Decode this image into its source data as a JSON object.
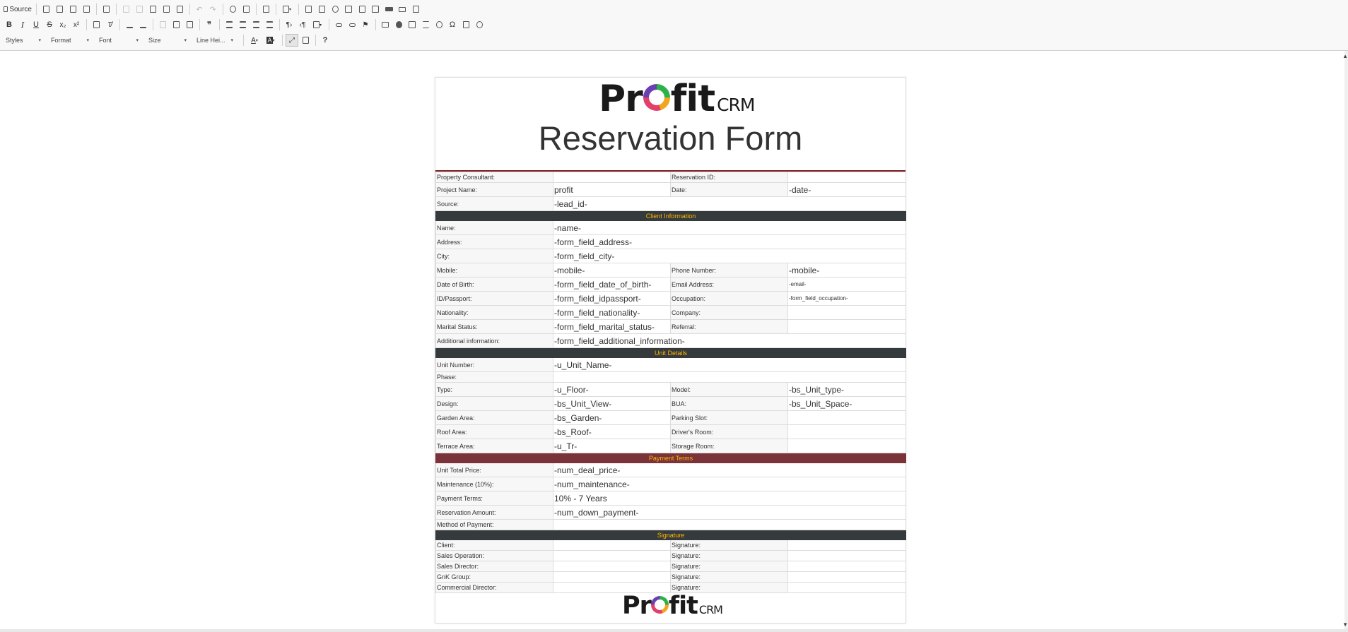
{
  "toolbar": {
    "source_label": "Source",
    "styles_label": "Styles",
    "format_label": "Format",
    "font_label": "Font",
    "size_label": "Size",
    "line_height_label": "Line Hei...",
    "bold": "B",
    "italic": "I",
    "underline": "U",
    "strike": "S",
    "subscript": "x₂",
    "superscript": "x²",
    "blockquote": "❞",
    "omega": "Ω",
    "help": "?",
    "text_color": "A",
    "bg_color": "A"
  },
  "document": {
    "logo": {
      "pro": "Pr",
      "fit": "fit",
      "crm": "CRM"
    },
    "title": "Reservation Form",
    "header_rows": [
      {
        "l1": "Property Consultant:",
        "v1": "",
        "l2": "Reservation ID:",
        "v2": ""
      },
      {
        "l1": "Project Name:",
        "v1": "profit",
        "l2": "Date:",
        "v2": "-date-"
      }
    ],
    "source": {
      "label": "Source:",
      "value": "-lead_id-"
    },
    "sections": {
      "client": "Client Information",
      "unit": "Unit Details",
      "payment": "Payment Terms",
      "signature": "Signature"
    },
    "client": {
      "name": {
        "label": "Name:",
        "value": "-name-"
      },
      "address": {
        "label": "Address:",
        "value": "-form_field_address-"
      },
      "city": {
        "label": "City:",
        "value": "-form_field_city-"
      },
      "mobile": {
        "label": "Mobile:",
        "value": "-mobile-",
        "label2": "Phone Number:",
        "value2": "-mobile-"
      },
      "dob": {
        "label": "Date of Birth:",
        "value": "-form_field_date_of_birth-",
        "label2": "Email Address:",
        "value2": "-email-"
      },
      "id": {
        "label": "ID/Passport:",
        "value": "-form_field_idpassport-",
        "label2": "Occupation:",
        "value2": "-form_field_occupation-"
      },
      "nationality": {
        "label": "Nationality:",
        "value": "-form_field_nationality-",
        "label2": "Company:",
        "value2": ""
      },
      "marital": {
        "label": "Marital Status:",
        "value": "-form_field_marital_status-",
        "label2": "Referral:",
        "value2": ""
      },
      "additional": {
        "label": "Additional information:",
        "value": "-form_field_additional_information-"
      }
    },
    "unit": {
      "number": {
        "label": "Unit Number:",
        "value": "-u_Unit_Name-"
      },
      "phase": {
        "label": "Phase:",
        "value": ""
      },
      "type": {
        "label": "Type:",
        "value": "-u_Floor-",
        "label2": "Model:",
        "value2": "-bs_Unit_type-"
      },
      "design": {
        "label": "Design:",
        "value": "-bs_Unit_View-",
        "label2": "BUA:",
        "value2": "-bs_Unit_Space-"
      },
      "garden": {
        "label": "Garden Area:",
        "value": "-bs_Garden-",
        "label2": "Parking Slot:",
        "value2": ""
      },
      "roof": {
        "label": "Roof Area:",
        "value": "-bs_Roof-",
        "label2": "Driver's Room:",
        "value2": ""
      },
      "terrace": {
        "label": "Terrace Area:",
        "value": "-u_Tr-",
        "label2": "Storage Room:",
        "value2": ""
      }
    },
    "payment": {
      "total": {
        "label": "Unit Total Price:",
        "value": "-num_deal_price-"
      },
      "maintenance": {
        "label": "Maintenance (10%):",
        "value": "-num_maintenance-"
      },
      "terms": {
        "label": "Payment Terms:",
        "value": "10% - 7 Years"
      },
      "reservation": {
        "label": "Reservation Amount:",
        "value": "-num_down_payment-"
      },
      "method": {
        "label": "Method of Payment:",
        "value": ""
      }
    },
    "signatures": [
      {
        "role": "Client:",
        "sig": "Signature:"
      },
      {
        "role": "Sales Operation:",
        "sig": "Signature:"
      },
      {
        "role": "Sales Director:",
        "sig": "Signature:"
      },
      {
        "role": "GnK Group:",
        "sig": "Signature:"
      },
      {
        "role": "Commercial Director:",
        "sig": "Signature:"
      }
    ]
  }
}
